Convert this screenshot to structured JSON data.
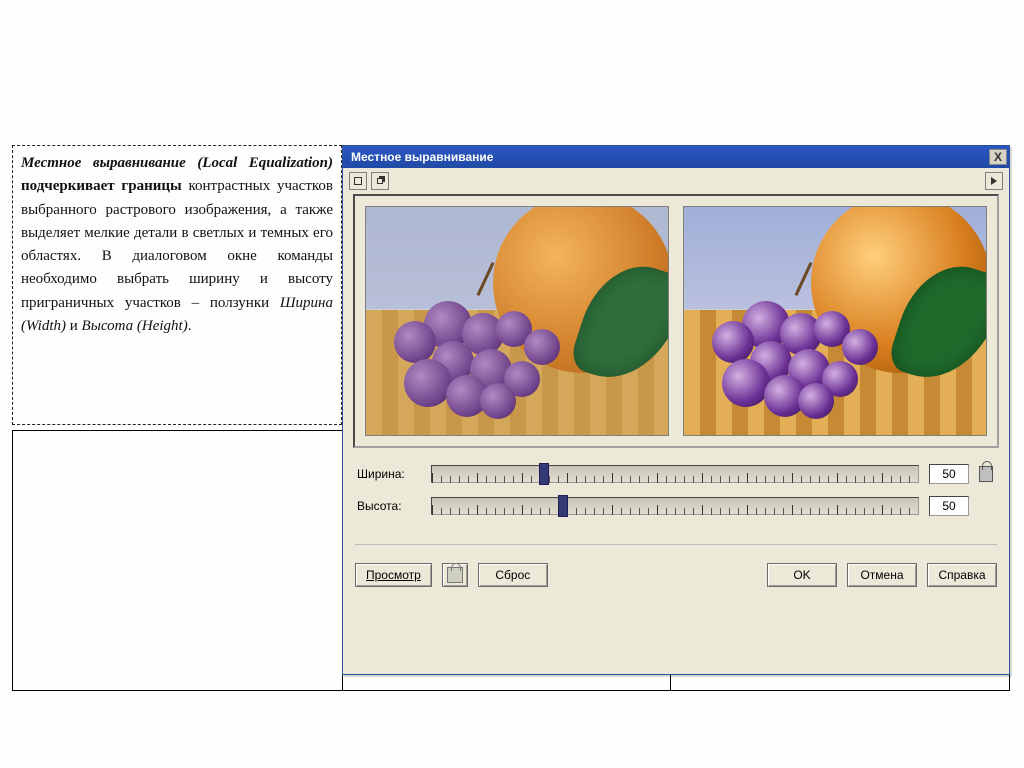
{
  "doc": {
    "paragraph_html": "<span class='lead1'>Местное выравнивание (Local Equalization)</span> <span class='b'>подчеркивает границы</span> контрастных участков выбранного растрового изображения, а также выделяет мелкие детали в светлых и темных его областях. В диалоговом окне команды необходимо выбрать ширину и высоту приграничных участков – ползунки <span class='slider-names'>Ширина (Width)</span> и <span class='slider-names'>Высота (Height)</span>."
  },
  "dialog": {
    "title": "Местное выравнивание",
    "close": "X",
    "sliders": {
      "width": {
        "label": "Ширина:",
        "value": "50",
        "percent": 22
      },
      "height": {
        "label": "Высота:",
        "value": "50",
        "percent": 26
      }
    },
    "buttons": {
      "preview": "Просмотр",
      "reset": "Сброс",
      "ok": "OK",
      "cancel": "Отмена",
      "help": "Справка"
    }
  }
}
